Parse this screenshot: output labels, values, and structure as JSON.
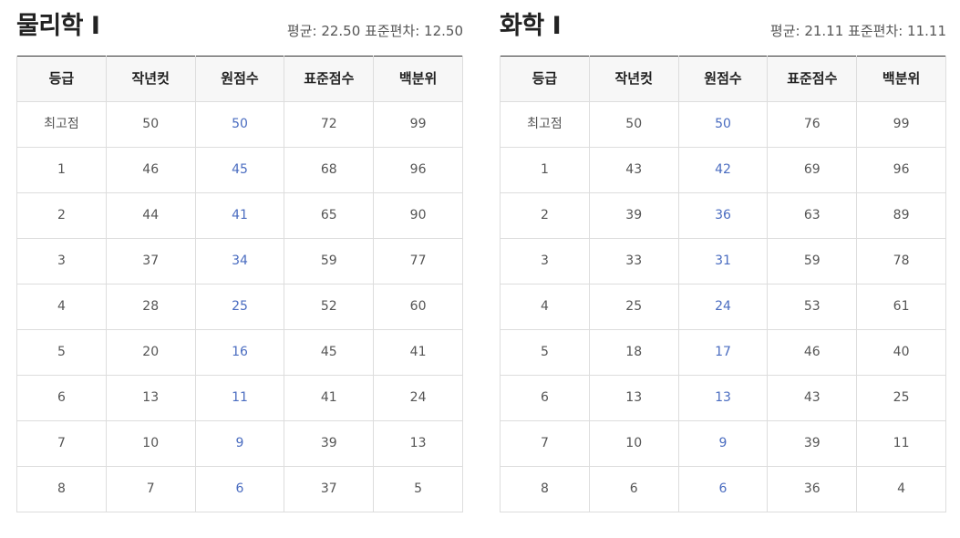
{
  "panels": [
    {
      "title": "물리학 Ⅰ",
      "stats": "평균: 22.50 표준편차: 12.50",
      "headers": [
        "등급",
        "작년컷",
        "원점수",
        "표준점수",
        "백분위"
      ],
      "rows": [
        [
          "최고점",
          "50",
          "50",
          "72",
          "99"
        ],
        [
          "1",
          "46",
          "45",
          "68",
          "96"
        ],
        [
          "2",
          "44",
          "41",
          "65",
          "90"
        ],
        [
          "3",
          "37",
          "34",
          "59",
          "77"
        ],
        [
          "4",
          "28",
          "25",
          "52",
          "60"
        ],
        [
          "5",
          "20",
          "16",
          "45",
          "41"
        ],
        [
          "6",
          "13",
          "11",
          "41",
          "24"
        ],
        [
          "7",
          "10",
          "9",
          "39",
          "13"
        ],
        [
          "8",
          "7",
          "6",
          "37",
          "5"
        ]
      ]
    },
    {
      "title": "화학 Ⅰ",
      "stats": "평균: 21.11 표준편차: 11.11",
      "headers": [
        "등급",
        "작년컷",
        "원점수",
        "표준점수",
        "백분위"
      ],
      "rows": [
        [
          "최고점",
          "50",
          "50",
          "76",
          "99"
        ],
        [
          "1",
          "43",
          "42",
          "69",
          "96"
        ],
        [
          "2",
          "39",
          "36",
          "63",
          "89"
        ],
        [
          "3",
          "33",
          "31",
          "59",
          "78"
        ],
        [
          "4",
          "25",
          "24",
          "53",
          "61"
        ],
        [
          "5",
          "18",
          "17",
          "46",
          "40"
        ],
        [
          "6",
          "13",
          "13",
          "43",
          "25"
        ],
        [
          "7",
          "10",
          "9",
          "39",
          "11"
        ],
        [
          "8",
          "6",
          "6",
          "36",
          "4"
        ]
      ]
    }
  ],
  "colors": {
    "raw_score_accent": "#4a6cc0",
    "header_background": "#f7f7f7",
    "border": "#dddddd"
  }
}
